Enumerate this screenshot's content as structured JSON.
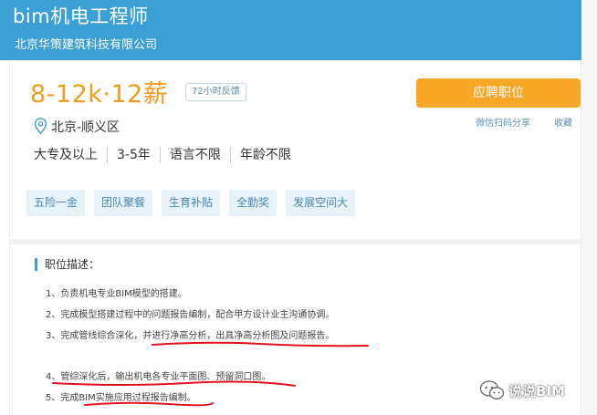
{
  "header": {
    "job_title": "bim机电工程师",
    "company": "北京华策建筑科技有限公司"
  },
  "job": {
    "salary": "8-12k·12薪",
    "response_badge": "72小时反馈",
    "location": "北京-顺义区",
    "requirements": [
      "大专及以上",
      "3-5年",
      "语言不限",
      "年龄不限"
    ],
    "benefits": [
      "五险一金",
      "团队聚餐",
      "生育补贴",
      "全勤奖",
      "发展空间大"
    ]
  },
  "actions": {
    "apply_label": "应聘职位",
    "wechat_share": "微信扫码分享",
    "favorite": "收藏"
  },
  "description": {
    "title": "职位描述：",
    "items": [
      "1、负责机电专业BIM模型的搭建。",
      "2、完成模型搭建过程中的问题报告编制，配合甲方设计业主沟通协调。",
      "3、完成管线综合深化，并进行净高分析，出具净高分析图及问题报告。",
      "4、管综深化后，输出机电各专业平面图、预留洞口图。",
      "5、完成BIM实施应用过程报告编制。"
    ]
  },
  "watermark": {
    "text": "说说BIM",
    "icon": "wechat-icon"
  },
  "colors": {
    "header": "#3aa0d5",
    "salary": "#f29d1f",
    "apply": "#f8a626",
    "tag_bg": "#e8f2f9",
    "annotation": "#e0141e"
  }
}
